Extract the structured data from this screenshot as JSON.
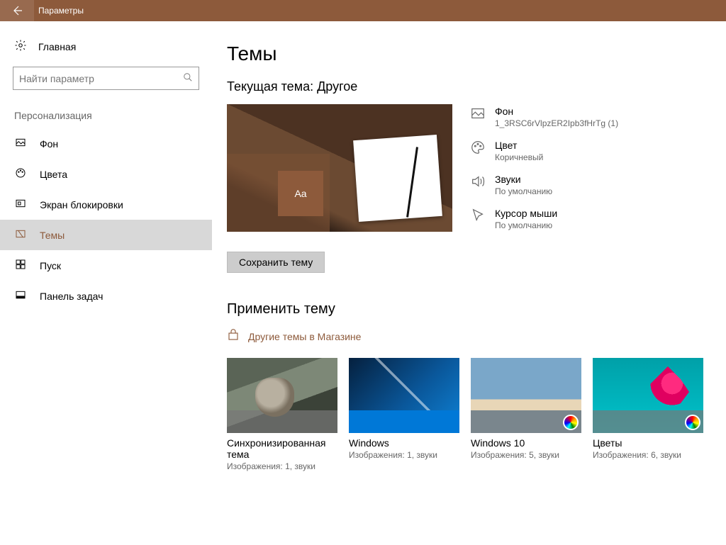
{
  "titlebar": {
    "title": "Параметры"
  },
  "sidebar": {
    "home": "Главная",
    "search_placeholder": "Найти параметр",
    "section": "Персонализация",
    "items": [
      {
        "label": "Фон"
      },
      {
        "label": "Цвета"
      },
      {
        "label": "Экран блокировки"
      },
      {
        "label": "Темы"
      },
      {
        "label": "Пуск"
      },
      {
        "label": "Панель задач"
      }
    ]
  },
  "main": {
    "heading": "Темы",
    "current_theme_label": "Текущая тема: Другое",
    "preview_sample": "Aa",
    "props": {
      "background": {
        "title": "Фон",
        "value": "1_3RSC6rVlpzER2Ipb3fHrTg (1)"
      },
      "color": {
        "title": "Цвет",
        "value": "Коричневый"
      },
      "sounds": {
        "title": "Звуки",
        "value": "По умолчанию"
      },
      "cursor": {
        "title": "Курсор мыши",
        "value": "По умолчанию"
      }
    },
    "save_button": "Сохранить тему",
    "apply_heading": "Применить тему",
    "store_link": "Другие темы в Магазине",
    "themes": [
      {
        "title": "Синхронизированная тема",
        "sub": "Изображения: 1, звуки"
      },
      {
        "title": "Windows",
        "sub": "Изображения: 1, звуки"
      },
      {
        "title": "Windows 10",
        "sub": "Изображения: 5, звуки"
      },
      {
        "title": "Цветы",
        "sub": "Изображения: 6, звуки"
      }
    ]
  }
}
